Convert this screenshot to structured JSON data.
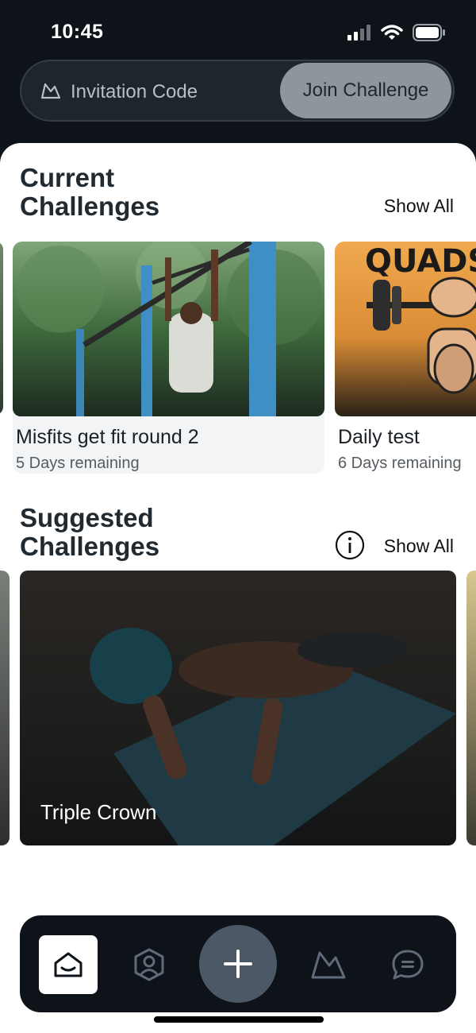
{
  "status_bar": {
    "time": "10:45"
  },
  "invite": {
    "placeholder": "Invitation Code",
    "join_label": "Join Challenge"
  },
  "current": {
    "title": "Current Challenges",
    "show_all": "Show All",
    "cards": [
      {
        "title": "Misfits get fit round 2",
        "subtitle": "5 Days remaining"
      },
      {
        "title": "Daily test",
        "subtitle": "6 Days remaining",
        "image_text": "QUADS"
      }
    ]
  },
  "suggested": {
    "title": "Suggested Challenges",
    "show_all": "Show All",
    "cards": [
      {
        "title": "Triple Crown"
      }
    ]
  },
  "nav": {
    "items": [
      {
        "icon": "home-icon",
        "active": true
      },
      {
        "icon": "profile-icon",
        "active": false
      },
      {
        "icon": "plus-icon",
        "active": false
      },
      {
        "icon": "mountain-icon",
        "active": false
      },
      {
        "icon": "chat-icon",
        "active": false
      }
    ]
  },
  "colors": {
    "accent": "#4c5866",
    "dark": "#0d1318",
    "join_button": "#8e969c"
  }
}
